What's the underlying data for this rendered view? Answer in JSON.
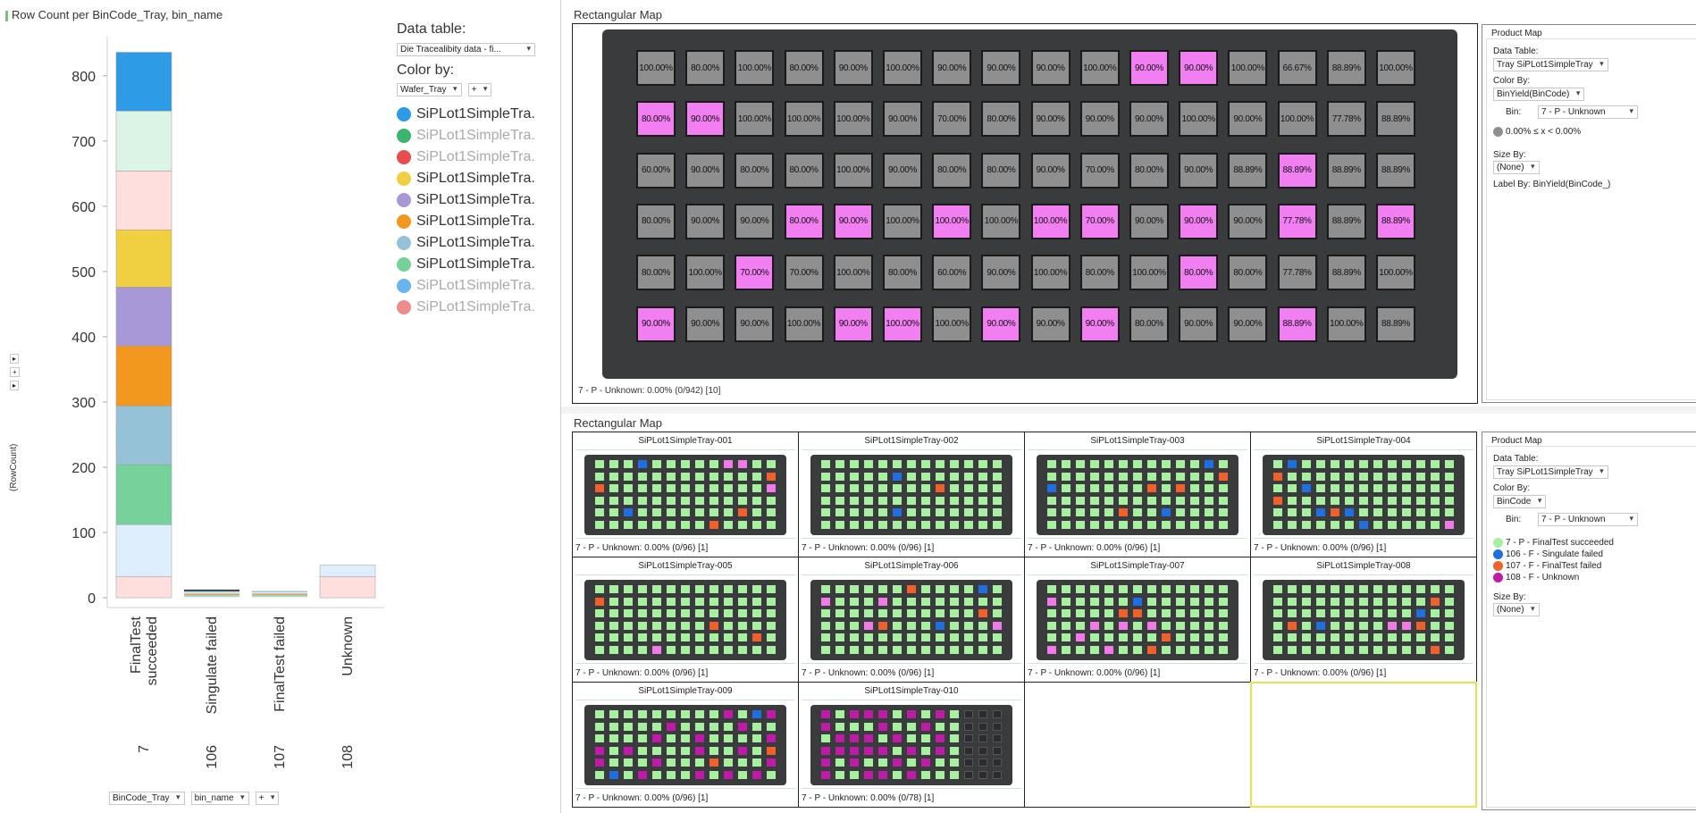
{
  "bar_panel": {
    "title": "Row Count per BinCode_Tray, bin_name",
    "data_table_label": "Data table:",
    "data_table_value": "Die Tracealibity data - fi...",
    "color_by_label": "Color by:",
    "color_by_value": "Wafer_Tray",
    "plus_label": "+",
    "y_axis_label": "(RowCount)",
    "x_selector_1": "BinCode_Tray",
    "x_selector_2": "bin_name",
    "x_selector_plus": "+",
    "side_buttons": [
      "▸",
      "+",
      "▸"
    ],
    "legend": [
      {
        "label": "SiPLot1SimpleTra...",
        "color": "#2e9be6",
        "faded": false
      },
      {
        "label": "SiPLot1SimpleTra...",
        "color": "#3cb46b",
        "faded": true
      },
      {
        "label": "SiPLot1SimpleTra...",
        "color": "#e84c4c",
        "faded": true
      },
      {
        "label": "SiPLot1SimpleTra...",
        "color": "#f0d040",
        "faded": false
      },
      {
        "label": "SiPLot1SimpleTra...",
        "color": "#a898d8",
        "faded": false
      },
      {
        "label": "SiPLot1SimpleTra...",
        "color": "#f3981f",
        "faded": false
      },
      {
        "label": "SiPLot1SimpleTra...",
        "color": "#96c2d8",
        "faded": false
      },
      {
        "label": "SiPLot1SimpleTra...",
        "color": "#76d29a",
        "faded": false
      },
      {
        "label": "SiPLot1SimpleTra...",
        "color": "#6ab4ee",
        "faded": true
      },
      {
        "label": "SiPLot1SimpleTra...",
        "color": "#ee8c8c",
        "faded": true
      }
    ]
  },
  "chart_data": {
    "type": "bar",
    "stacked": true,
    "title": "Row Count per BinCode_Tray, bin_name",
    "xlabel": "",
    "ylabel": "(RowCount)",
    "ylim": [
      -15,
      860
    ],
    "yticks": [
      0,
      100,
      200,
      300,
      400,
      500,
      600,
      700,
      800
    ],
    "categories": [
      {
        "code": "7",
        "name": "FinalTest succeeded"
      },
      {
        "code": "106",
        "name": "Singulate failed"
      },
      {
        "code": "107",
        "name": "FinalTest failed"
      },
      {
        "code": "108",
        "name": "Unknown"
      }
    ],
    "series": [
      {
        "color": "#ffdede",
        "values": [
          32,
          1,
          1,
          32
        ]
      },
      {
        "color": "#deeefc",
        "values": [
          80,
          1,
          1,
          18
        ]
      },
      {
        "color": "#76d29a",
        "values": [
          92,
          1,
          1,
          0
        ]
      },
      {
        "color": "#96c2d8",
        "values": [
          90,
          1,
          1,
          0
        ]
      },
      {
        "color": "#f3981f",
        "values": [
          92,
          1,
          1,
          0
        ]
      },
      {
        "color": "#a898d8",
        "values": [
          90,
          1,
          1,
          0
        ]
      },
      {
        "color": "#f0d040",
        "values": [
          88,
          1,
          1,
          0
        ]
      },
      {
        "color": "#ffdede",
        "values": [
          90,
          1,
          1,
          0
        ]
      },
      {
        "color": "#dcf4e6",
        "values": [
          92,
          1,
          1,
          0
        ]
      },
      {
        "color": "#2e9be6",
        "values": [
          90,
          1,
          1,
          0
        ]
      }
    ]
  },
  "top_map": {
    "title": "Rectangular Map",
    "footer": "7 - P - Unknown: 0.00% (0/942) [10]",
    "rows": [
      [
        "100.00%",
        "80.00%",
        "100.00%",
        "80.00%",
        "90.00%",
        "100.00%",
        "90.00%",
        "90.00%",
        "90.00%",
        "100.00%",
        "90.00%",
        "90.00%",
        "100.00%",
        "66.67%",
        "88.89%",
        "100.00%"
      ],
      [
        "80.00%",
        "90.00%",
        "100.00%",
        "100.00%",
        "100.00%",
        "90.00%",
        "70.00%",
        "80.00%",
        "90.00%",
        "90.00%",
        "90.00%",
        "100.00%",
        "90.00%",
        "100.00%",
        "77.78%",
        "88.89%"
      ],
      [
        "60.00%",
        "90.00%",
        "80.00%",
        "80.00%",
        "100.00%",
        "90.00%",
        "80.00%",
        "80.00%",
        "90.00%",
        "70.00%",
        "80.00%",
        "90.00%",
        "88.89%",
        "88.89%",
        "88.89%",
        "88.89%"
      ],
      [
        "80.00%",
        "90.00%",
        "90.00%",
        "80.00%",
        "90.00%",
        "100.00%",
        "100.00%",
        "100.00%",
        "100.00%",
        "70.00%",
        "90.00%",
        "90.00%",
        "90.00%",
        "77.78%",
        "88.89%",
        "88.89%"
      ],
      [
        "80.00%",
        "100.00%",
        "70.00%",
        "70.00%",
        "100.00%",
        "80.00%",
        "60.00%",
        "90.00%",
        "100.00%",
        "80.00%",
        "100.00%",
        "80.00%",
        "80.00%",
        "77.78%",
        "88.89%",
        "100.00%"
      ],
      [
        "90.00%",
        "90.00%",
        "90.00%",
        "100.00%",
        "90.00%",
        "100.00%",
        "100.00%",
        "90.00%",
        "90.00%",
        "90.00%",
        "80.00%",
        "90.00%",
        "90.00%",
        "88.89%",
        "100.00%",
        "88.89%"
      ]
    ],
    "pink": [
      [
        10,
        11
      ],
      [
        0,
        1
      ],
      [
        13
      ],
      [
        3,
        4,
        6,
        8,
        9,
        11,
        13,
        15
      ],
      [
        2,
        11
      ],
      [
        0,
        4,
        5,
        7,
        9,
        13
      ]
    ]
  },
  "top_product_map": {
    "header": "Product Map",
    "data_table_label": "Data Table:",
    "data_table_value": "Tray SiPLot1SimpleTray",
    "color_by_label": "Color By:",
    "color_by_value": "BinYield(BinCode)",
    "bin_label": "Bin:",
    "bin_value": "7 - P - Unknown",
    "range_label": "0.00% ≤ x < 0.00%",
    "size_by_label": "Size By:",
    "size_by_value": "(None)",
    "label_by": "Label By: BinYield(BinCode_)"
  },
  "bottom_map": {
    "title": "Rectangular Map",
    "colors": {
      "green": "#a7f0a0",
      "blue": "#1f6fe0",
      "red": "#f0602a",
      "pink": "#f07ae6",
      "magenta": "#c01aa8",
      "dark": "#2c2c2c"
    },
    "trays": [
      {
        "title": "SiPLot1SimpleTray-001",
        "footer": "7 - P - Unknown: 0.00% (0/96) [1]",
        "special": [
          [
            0,
            3,
            "blue"
          ],
          [
            0,
            9,
            "pink"
          ],
          [
            0,
            10,
            "pink"
          ],
          [
            1,
            12,
            "red"
          ],
          [
            2,
            0,
            "red"
          ],
          [
            2,
            12,
            "pink"
          ],
          [
            4,
            2,
            "blue"
          ],
          [
            4,
            10,
            "red"
          ],
          [
            5,
            8,
            "red"
          ]
        ],
        "dark_cols": 0
      },
      {
        "title": "SiPLot1SimpleTray-002",
        "footer": "7 - P - Unknown: 0.00% (0/96) [1]",
        "special": [
          [
            1,
            5,
            "blue"
          ],
          [
            2,
            8,
            "red"
          ],
          [
            4,
            5,
            "blue"
          ]
        ],
        "dark_cols": 0
      },
      {
        "title": "SiPLot1SimpleTray-003",
        "footer": "7 - P - Unknown: 0.00% (0/96) [1]",
        "special": [
          [
            0,
            11,
            "blue"
          ],
          [
            1,
            12,
            "red"
          ],
          [
            2,
            0,
            "blue"
          ],
          [
            2,
            7,
            "red"
          ],
          [
            2,
            9,
            "red"
          ],
          [
            4,
            5,
            "red"
          ],
          [
            4,
            8,
            "blue"
          ]
        ],
        "dark_cols": 0
      },
      {
        "title": "SiPLot1SimpleTray-004",
        "footer": "7 - P - Unknown: 0.00% (0/96) [1]",
        "special": [
          [
            0,
            1,
            "blue"
          ],
          [
            1,
            0,
            "red"
          ],
          [
            2,
            2,
            "blue"
          ],
          [
            3,
            0,
            "red"
          ],
          [
            4,
            3,
            "blue"
          ],
          [
            4,
            4,
            "red"
          ],
          [
            4,
            5,
            "blue"
          ],
          [
            5,
            6,
            "blue"
          ],
          [
            5,
            12,
            "pink"
          ]
        ],
        "dark_cols": 0
      },
      {
        "title": "SiPLot1SimpleTray-005",
        "footer": "7 - P - Unknown: 0.00% (0/96) [1]",
        "special": [
          [
            1,
            0,
            "red"
          ],
          [
            3,
            8,
            "red"
          ],
          [
            4,
            11,
            "red"
          ],
          [
            5,
            4,
            "pink"
          ]
        ],
        "dark_cols": 0
      },
      {
        "title": "SiPLot1SimpleTray-006",
        "footer": "7 - P - Unknown: 0.00% (0/96) [1]",
        "special": [
          [
            0,
            6,
            "red"
          ],
          [
            0,
            11,
            "blue"
          ],
          [
            1,
            0,
            "pink"
          ],
          [
            1,
            4,
            "pink"
          ],
          [
            2,
            11,
            "red"
          ],
          [
            3,
            3,
            "pink"
          ],
          [
            3,
            4,
            "red"
          ],
          [
            3,
            8,
            "blue"
          ],
          [
            3,
            12,
            "pink"
          ]
        ],
        "dark_cols": 0
      },
      {
        "title": "SiPLot1SimpleTray-007",
        "footer": "7 - P - Unknown: 0.00% (0/96) [1]",
        "special": [
          [
            1,
            0,
            "pink"
          ],
          [
            1,
            6,
            "blue"
          ],
          [
            2,
            5,
            "red"
          ],
          [
            2,
            6,
            "red"
          ],
          [
            3,
            3,
            "pink"
          ],
          [
            3,
            5,
            "pink"
          ],
          [
            3,
            7,
            "pink"
          ],
          [
            4,
            2,
            "pink"
          ],
          [
            4,
            8,
            "red"
          ],
          [
            5,
            0,
            "pink"
          ],
          [
            5,
            4,
            "pink"
          ],
          [
            5,
            7,
            "red"
          ]
        ],
        "dark_cols": 0
      },
      {
        "title": "SiPLot1SimpleTray-008",
        "footer": "7 - P - Unknown: 0.00% (0/96) [1]",
        "special": [
          [
            1,
            11,
            "red"
          ],
          [
            2,
            10,
            "blue"
          ],
          [
            3,
            1,
            "red"
          ],
          [
            3,
            3,
            "blue"
          ],
          [
            3,
            8,
            "pink"
          ],
          [
            3,
            9,
            "pink"
          ],
          [
            3,
            10,
            "red"
          ],
          [
            5,
            11,
            "red"
          ]
        ],
        "dark_cols": 0
      },
      {
        "title": "SiPLot1SimpleTray-009",
        "footer": "7 - P - Unknown: 0.00% (0/96) [1]",
        "special": [
          [
            0,
            9,
            "magenta"
          ],
          [
            0,
            11,
            "blue"
          ],
          [
            0,
            12,
            "magenta"
          ],
          [
            1,
            5,
            "magenta"
          ],
          [
            1,
            10,
            "magenta"
          ],
          [
            2,
            4,
            "magenta"
          ],
          [
            2,
            7,
            "magenta"
          ],
          [
            2,
            12,
            "magenta"
          ],
          [
            3,
            0,
            "magenta"
          ],
          [
            3,
            2,
            "magenta"
          ],
          [
            3,
            7,
            "magenta"
          ],
          [
            3,
            10,
            "magenta"
          ],
          [
            3,
            12,
            "red"
          ],
          [
            4,
            0,
            "magenta"
          ],
          [
            4,
            4,
            "magenta"
          ],
          [
            4,
            8,
            "red"
          ],
          [
            4,
            12,
            "magenta"
          ],
          [
            5,
            1,
            "blue"
          ],
          [
            5,
            3,
            "magenta"
          ],
          [
            5,
            7,
            "magenta"
          ],
          [
            5,
            9,
            "magenta"
          ],
          [
            5,
            11,
            "magenta"
          ]
        ],
        "dark_cols": 0
      },
      {
        "title": "SiPLot1SimpleTray-010",
        "footer": "7 - P - Unknown: 0.00% (0/78) [1]",
        "special": [
          [
            0,
            0,
            "magenta"
          ],
          [
            0,
            2,
            "magenta"
          ],
          [
            0,
            3,
            "magenta"
          ],
          [
            0,
            4,
            "magenta"
          ],
          [
            0,
            6,
            "magenta"
          ],
          [
            0,
            8,
            "magenta"
          ],
          [
            1,
            0,
            "magenta"
          ],
          [
            1,
            4,
            "magenta"
          ],
          [
            1,
            7,
            "magenta"
          ],
          [
            2,
            1,
            "magenta"
          ],
          [
            2,
            2,
            "magenta"
          ],
          [
            2,
            3,
            "magenta"
          ],
          [
            2,
            5,
            "magenta"
          ],
          [
            2,
            8,
            "magenta"
          ],
          [
            3,
            0,
            "magenta"
          ],
          [
            3,
            1,
            "magenta"
          ],
          [
            3,
            2,
            "magenta"
          ],
          [
            3,
            3,
            "magenta"
          ],
          [
            3,
            4,
            "magenta"
          ],
          [
            3,
            6,
            "magenta"
          ],
          [
            3,
            8,
            "magenta"
          ],
          [
            4,
            0,
            "magenta"
          ],
          [
            4,
            2,
            "magenta"
          ],
          [
            4,
            5,
            "magenta"
          ],
          [
            4,
            7,
            "magenta"
          ],
          [
            5,
            0,
            "magenta"
          ],
          [
            5,
            3,
            "magenta"
          ],
          [
            5,
            4,
            "magenta"
          ],
          [
            5,
            6,
            "magenta"
          ]
        ],
        "dark_cols": 3
      }
    ]
  },
  "bottom_product_map": {
    "header": "Product Map",
    "data_table_label": "Data Table:",
    "data_table_value": "Tray SiPLot1SimpleTray",
    "color_by_label": "Color By:",
    "color_by_value": "BinCode",
    "bin_label": "Bin:",
    "bin_value": "7 - P - Unknown",
    "legend": [
      {
        "label": "7 - P - FinalTest succeeded",
        "color": "#a7f0a0"
      },
      {
        "label": "106 - F - Singulate failed",
        "color": "#1f6fe0"
      },
      {
        "label": "107 - F - FinalTest failed",
        "color": "#f0602a"
      },
      {
        "label": "108 - F - Unknown",
        "color": "#c01aa8"
      }
    ],
    "size_by_label": "Size By:",
    "size_by_value": "(None)"
  }
}
